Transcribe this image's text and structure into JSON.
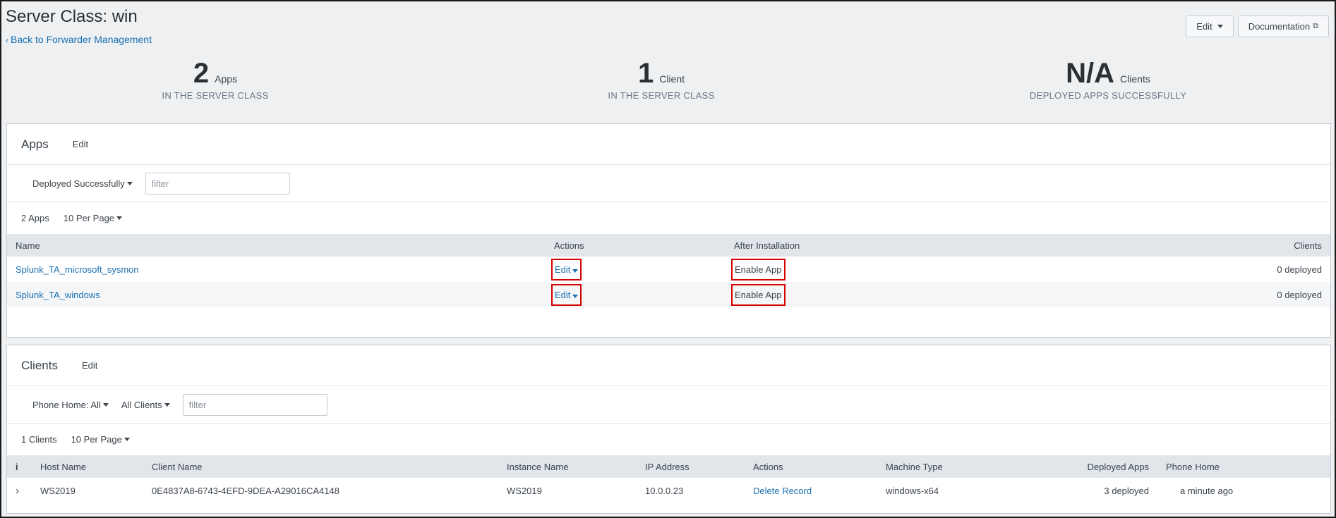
{
  "header": {
    "title": "Server Class: win",
    "back_label": "Back to Forwarder Management",
    "edit_label": "Edit",
    "docs_label": "Documentation"
  },
  "stats": [
    {
      "number": "2",
      "unit": "Apps",
      "sub": "IN THE SERVER CLASS"
    },
    {
      "number": "1",
      "unit": "Client",
      "sub": "IN THE SERVER CLASS"
    },
    {
      "number": "N/A",
      "unit": "Clients",
      "sub": "DEPLOYED APPS SUCCESSFULLY"
    }
  ],
  "apps": {
    "title": "Apps",
    "edit_label": "Edit",
    "status_filter": "Deployed Successfully",
    "filter_placeholder": "filter",
    "count_label": "2 Apps",
    "per_page": "10 Per Page",
    "columns": [
      "Name",
      "Actions",
      "After Installation",
      "Clients"
    ],
    "rows": [
      {
        "name": "Splunk_TA_microsoft_sysmon",
        "action": "Edit",
        "after": "Enable App",
        "clients": "0 deployed"
      },
      {
        "name": "Splunk_TA_windows",
        "action": "Edit",
        "after": "Enable App",
        "clients": "0 deployed"
      }
    ]
  },
  "clients": {
    "title": "Clients",
    "edit_label": "Edit",
    "phone_filter": "Phone Home: All",
    "clients_filter": "All Clients",
    "filter_placeholder": "filter",
    "count_label": "1 Clients",
    "per_page": "10 Per Page",
    "columns": [
      "i",
      "Host Name",
      "Client Name",
      "Instance Name",
      "IP Address",
      "Actions",
      "Machine Type",
      "Deployed Apps",
      "Phone Home"
    ],
    "rows": [
      {
        "host": "WS2019",
        "client": "0E4837A8-6743-4EFD-9DEA-A29016CA4148",
        "instance": "WS2019",
        "ip": "10.0.0.23",
        "action": "Delete Record",
        "machine": "windows-x64",
        "deployed": "3 deployed",
        "phone": "a minute ago"
      }
    ]
  }
}
